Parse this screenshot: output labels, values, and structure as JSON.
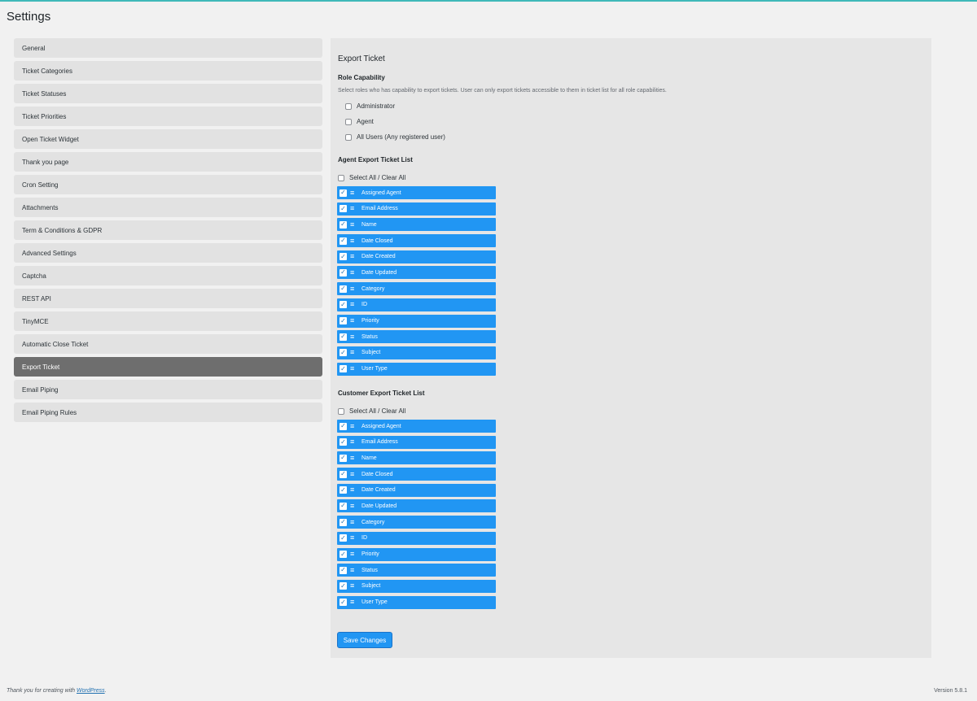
{
  "page": {
    "title": "Settings"
  },
  "sidebar": {
    "items": [
      {
        "label": "General",
        "active": false
      },
      {
        "label": "Ticket Categories",
        "active": false
      },
      {
        "label": "Ticket Statuses",
        "active": false
      },
      {
        "label": "Ticket Priorities",
        "active": false
      },
      {
        "label": "Open Ticket Widget",
        "active": false
      },
      {
        "label": "Thank you page",
        "active": false
      },
      {
        "label": "Cron Setting",
        "active": false
      },
      {
        "label": "Attachments",
        "active": false
      },
      {
        "label": "Term & Conditions & GDPR",
        "active": false
      },
      {
        "label": "Advanced Settings",
        "active": false
      },
      {
        "label": "Captcha",
        "active": false
      },
      {
        "label": "REST API",
        "active": false
      },
      {
        "label": "TinyMCE",
        "active": false
      },
      {
        "label": "Automatic Close Ticket",
        "active": false
      },
      {
        "label": "Export Ticket",
        "active": true
      },
      {
        "label": "Email Piping",
        "active": false
      },
      {
        "label": "Email Piping Rules",
        "active": false
      }
    ]
  },
  "main": {
    "section_title": "Export Ticket",
    "role_capability": {
      "heading": "Role Capability",
      "description": "Select roles who has capability to export tickets. User can only export tickets accessible to them in ticket list for all role capabilities.",
      "roles": [
        {
          "label": "Administrator",
          "checked": false
        },
        {
          "label": "Agent",
          "checked": false
        },
        {
          "label": "All Users (Any registered user)",
          "checked": false
        }
      ]
    },
    "agent_list": {
      "heading": "Agent Export Ticket List",
      "select_all_label": "Select All / Clear All",
      "items": [
        {
          "label": "Assigned Agent",
          "checked": true
        },
        {
          "label": "Email Address",
          "checked": true
        },
        {
          "label": "Name",
          "checked": true
        },
        {
          "label": "Date Closed",
          "checked": true
        },
        {
          "label": "Date Created",
          "checked": true
        },
        {
          "label": "Date Updated",
          "checked": true
        },
        {
          "label": "Category",
          "checked": true
        },
        {
          "label": "ID",
          "checked": true
        },
        {
          "label": "Priority",
          "checked": true
        },
        {
          "label": "Status",
          "checked": true
        },
        {
          "label": "Subject",
          "checked": true
        },
        {
          "label": "User Type",
          "checked": true
        }
      ]
    },
    "customer_list": {
      "heading": "Customer Export Ticket List",
      "select_all_label": "Select All / Clear All",
      "items": [
        {
          "label": "Assigned Agent",
          "checked": true
        },
        {
          "label": "Email Address",
          "checked": true
        },
        {
          "label": "Name",
          "checked": true
        },
        {
          "label": "Date Closed",
          "checked": true
        },
        {
          "label": "Date Created",
          "checked": true
        },
        {
          "label": "Date Updated",
          "checked": true
        },
        {
          "label": "Category",
          "checked": true
        },
        {
          "label": "ID",
          "checked": true
        },
        {
          "label": "Priority",
          "checked": true
        },
        {
          "label": "Status",
          "checked": true
        },
        {
          "label": "Subject",
          "checked": true
        },
        {
          "label": "User Type",
          "checked": true
        }
      ]
    },
    "save_label": "Save Changes"
  },
  "footer": {
    "thanks_prefix": "Thank you for creating with ",
    "link_text": "WordPress",
    "thanks_suffix": ".",
    "version": "Version 5.8.1"
  },
  "colors": {
    "accent": "#2196f3",
    "active_nav": "#6e6e6e",
    "top_bar": "#3fb9b9"
  },
  "icons": {
    "check": "check-icon",
    "drag": "drag-handle-icon"
  }
}
